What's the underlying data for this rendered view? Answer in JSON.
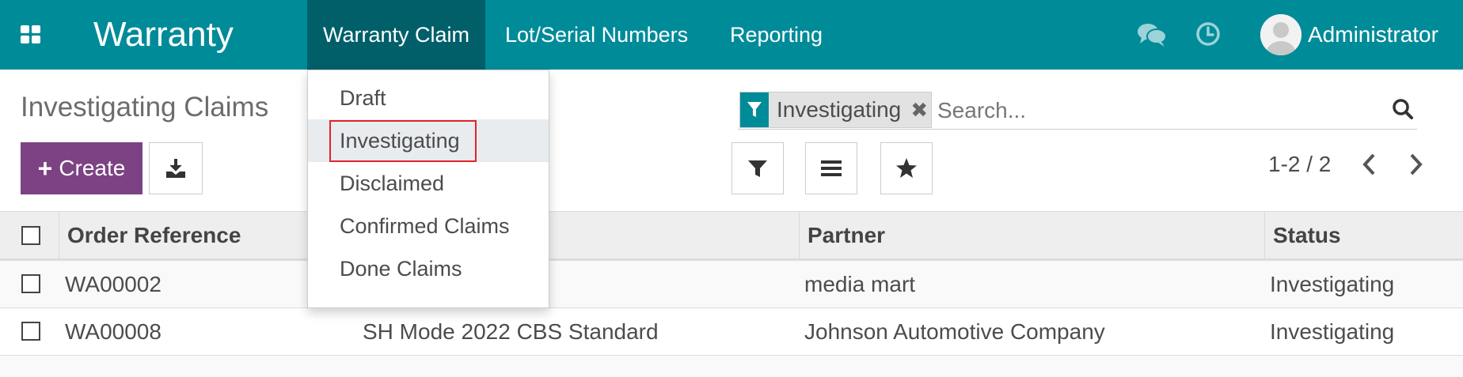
{
  "navbar": {
    "app_title": "Warranty",
    "menus": [
      "Warranty Claim",
      "Lot/Serial Numbers",
      "Reporting"
    ],
    "user_name": "Administrator"
  },
  "control_panel": {
    "breadcrumb": "Investigating Claims",
    "create_label": "Create",
    "search": {
      "facet_value": "Investigating",
      "placeholder": "Search..."
    },
    "pager": "1-2 / 2"
  },
  "dropdown": {
    "items": [
      "Draft",
      "Investigating",
      "Disclaimed",
      "Confirmed Claims",
      "Done Claims"
    ],
    "highlighted": "Investigating"
  },
  "table": {
    "columns": [
      "Order Reference",
      "",
      "Partner",
      "Status"
    ],
    "rows": [
      {
        "order_ref": "WA00002",
        "product": "",
        "partner": "media mart",
        "status": "Investigating"
      },
      {
        "order_ref": "WA00008",
        "product": "SH Mode 2022 CBS Standard",
        "partner": "Johnson Automotive Company",
        "status": "Investigating"
      }
    ]
  },
  "colors": {
    "navbar": "#008b99",
    "navbar_active": "#005f69",
    "primary_button": "#7c4283",
    "highlight_border": "#e0242a"
  },
  "icons": [
    "apps-icon",
    "chat-icon",
    "clock-icon",
    "avatar",
    "plus-icon",
    "download-icon",
    "filter-icon",
    "close-icon",
    "search-icon",
    "list-icon",
    "star-icon",
    "chevron-left-icon",
    "chevron-right-icon"
  ]
}
